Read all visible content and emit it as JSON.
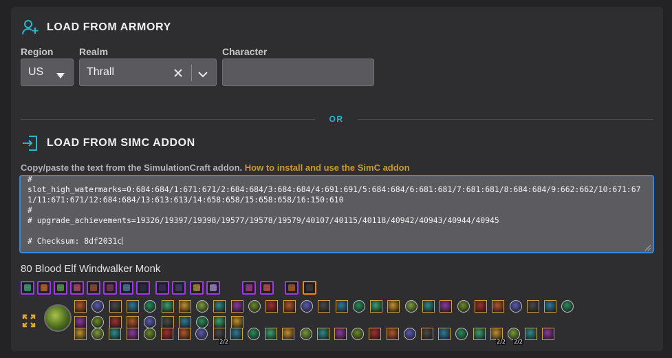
{
  "armory": {
    "title": "LOAD FROM ARMORY",
    "icon": "add-user-icon",
    "region_label": "Region",
    "region_value": "US",
    "realm_label": "Realm",
    "realm_value": "Thrall",
    "character_label": "Character",
    "character_value": ""
  },
  "divider": {
    "text": "OR"
  },
  "simc": {
    "title": "LOAD FROM SIMC ADDON",
    "icon": "import-icon",
    "instructions": "Copy/paste the text from the SimulationCraft addon.",
    "link_text": "How to install and use the SimC addon",
    "text": "#\nslot_high_watermarks=0:684:684/1:671:671/2:684:684/3:684:684/4:691:691/5:684:684/6:681:681/7:681:681/8:684:684/9:662:662/10:671:671/11:671:671/12:684:684/13:613:613/14:658:658/15:658:658/16:150:610\n#\n# upgrade_achievements=19326/19397/19398/19577/19578/19579/40107/40115/40118/40942/40943/40944/40945\n\n# Checksum: 8df2031c"
  },
  "character": {
    "summary": "80 Blood Elf Windwalker Monk"
  },
  "colors": {
    "accent_blue": "#3a87d8",
    "or_cyan": "#2bb8cf",
    "link_gold": "#c99a2e",
    "epic_purple": "#a335ee",
    "legendary_orange": "#ff8000"
  },
  "gear": [
    {
      "color": "#3aa37a",
      "quality": "epic"
    },
    {
      "color": "#c0662a",
      "quality": "epic"
    },
    {
      "color": "#5a9a4a",
      "quality": "epic"
    },
    {
      "color": "#b04a6a",
      "quality": "epic"
    },
    {
      "color": "#9a4a2a",
      "quality": "epic"
    },
    {
      "color": "#7a3a5a",
      "quality": "epic"
    },
    {
      "color": "#4a7aa0",
      "quality": "epic"
    },
    {
      "color": "#2a2a4a",
      "quality": "epic"
    },
    {
      "color": "#3a2a5a",
      "quality": "epic"
    },
    {
      "color": "#4a3a6a",
      "quality": "epic"
    },
    {
      "color": "#b08a30",
      "quality": "epic"
    },
    {
      "color": "#a08ac0",
      "quality": "epic"
    },
    {
      "color": "#a03a8a",
      "quality": "epic"
    },
    {
      "color": "#c05050",
      "quality": "epic"
    },
    {
      "color": "#b05a20",
      "quality": "epic"
    },
    {
      "color": "#3a3a3a",
      "quality": "legendary"
    }
  ],
  "talents": {
    "row1": 29,
    "row2": 10,
    "row3": 28,
    "ranks": [
      {
        "row": 3,
        "index": 8,
        "text": "2/2"
      },
      {
        "row": 3,
        "index": 24,
        "text": "2/2"
      },
      {
        "row": 3,
        "index": 25,
        "text": "2/2"
      }
    ]
  }
}
